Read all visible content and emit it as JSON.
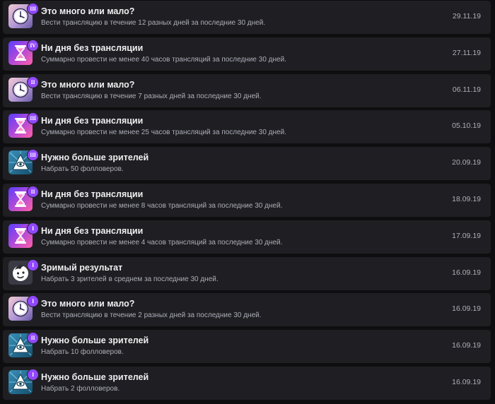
{
  "achievements": [
    {
      "title": "Это много или мало?",
      "description": "Вести трансляцию в течение 12 разных дней за последние 30 дней.",
      "date": "29.11.19",
      "tier": "III",
      "icon": "clock-icon"
    },
    {
      "title": "Ни дня без трансляции",
      "description": "Суммарно провести не менее 40 часов трансляций за последние 30 дней.",
      "date": "27.11.19",
      "tier": "IV",
      "icon": "hourglass-icon"
    },
    {
      "title": "Это много или мало?",
      "description": "Вести трансляцию в течение 7 разных дней за последние 30 дней.",
      "date": "06.11.19",
      "tier": "II",
      "icon": "clock-icon"
    },
    {
      "title": "Ни дня без трансляции",
      "description": "Суммарно провести не менее 25 часов трансляций за последние 30 дней.",
      "date": "05.10.19",
      "tier": "III",
      "icon": "hourglass-icon"
    },
    {
      "title": "Нужно больше зрителей",
      "description": "Набрать 50 фолловеров.",
      "date": "20.09.19",
      "tier": "III",
      "icon": "eye-pyramid-icon"
    },
    {
      "title": "Ни дня без трансляции",
      "description": "Суммарно провести не менее 8 часов трансляций за последние 30 дней.",
      "date": "18.09.19",
      "tier": "II",
      "icon": "hourglass-icon"
    },
    {
      "title": "Ни дня без трансляции",
      "description": "Суммарно провести не менее 4 часов трансляций за последние 30 дней.",
      "date": "17.09.19",
      "tier": "I",
      "icon": "hourglass-icon"
    },
    {
      "title": "Зримый результат",
      "description": "Набрать 3 зрителей в среднем за последние 30 дней.",
      "date": "16.09.19",
      "tier": "I",
      "icon": "face-icon"
    },
    {
      "title": "Это много или мало?",
      "description": "Вести трансляцию в течение 2 разных дней за последние 30 дней.",
      "date": "16.09.19",
      "tier": "I",
      "icon": "clock-icon"
    },
    {
      "title": "Нужно больше зрителей",
      "description": "Набрать 10 фолловеров.",
      "date": "16.09.19",
      "tier": "II",
      "icon": "eye-pyramid-icon"
    },
    {
      "title": "Нужно больше зрителей",
      "description": "Набрать 2 фолловеров.",
      "date": "16.09.19",
      "tier": "I",
      "icon": "eye-pyramid-icon"
    }
  ],
  "colors": {
    "background": "#0e0e10",
    "row": "#1f1f23",
    "tier_badge": "#9147ff",
    "title": "#efeff1",
    "secondary_text": "#adadb8"
  }
}
